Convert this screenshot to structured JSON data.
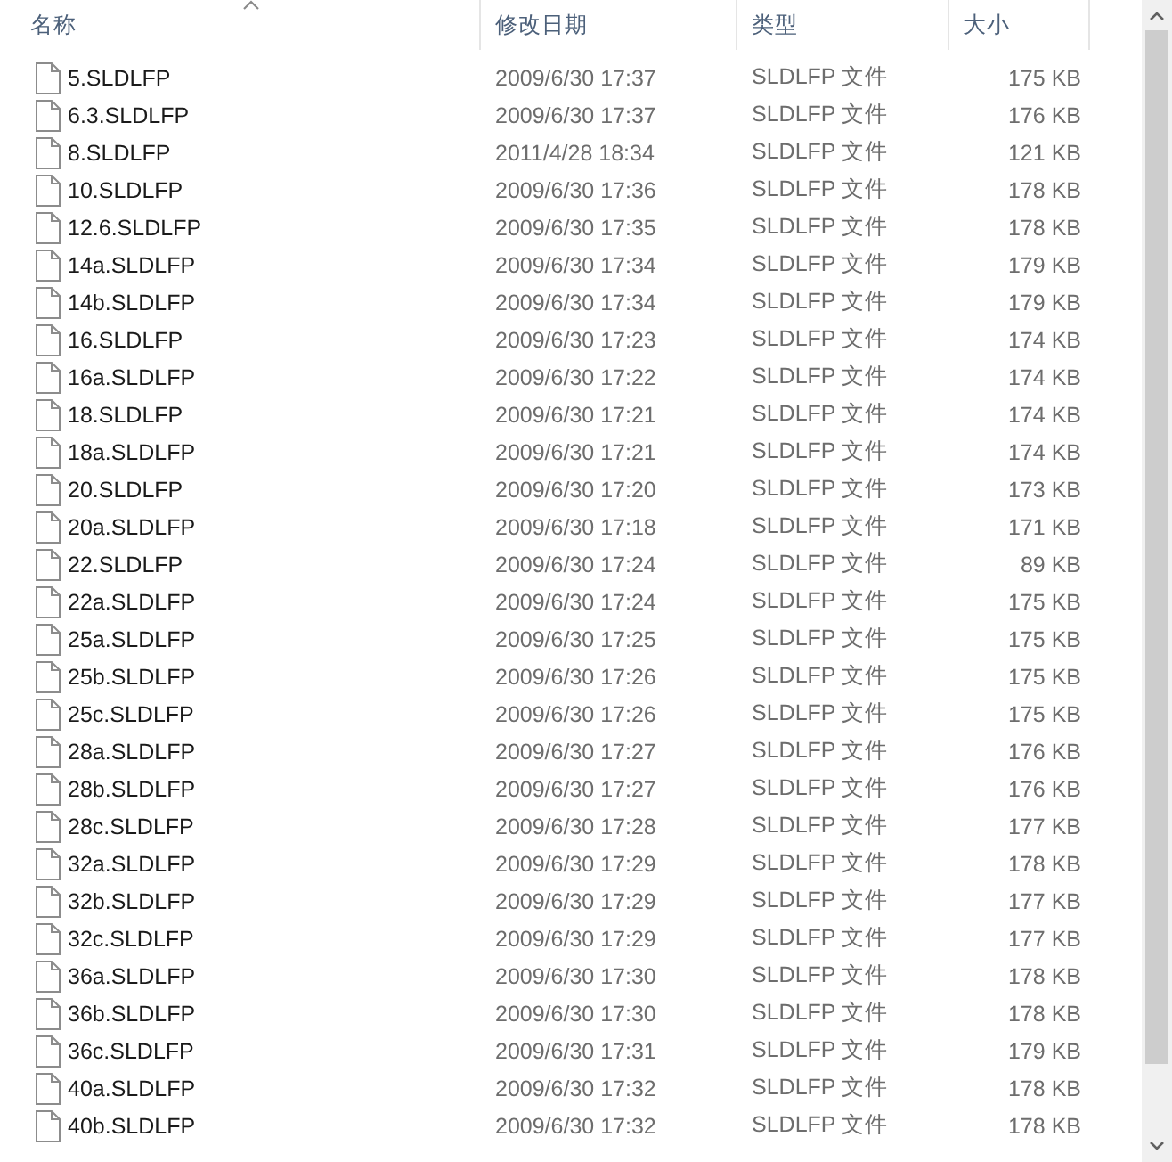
{
  "columns": [
    {
      "label": "名称",
      "sorted": true
    },
    {
      "label": "修改日期",
      "sorted": false
    },
    {
      "label": "类型",
      "sorted": false
    },
    {
      "label": "大小",
      "sorted": false
    }
  ],
  "rows": [
    {
      "name": "5.SLDLFP",
      "modified": "2009/6/30 17:37",
      "type": "SLDLFP 文件",
      "size": "175 KB"
    },
    {
      "name": "6.3.SLDLFP",
      "modified": "2009/6/30 17:37",
      "type": "SLDLFP 文件",
      "size": "176 KB"
    },
    {
      "name": "8.SLDLFP",
      "modified": "2011/4/28 18:34",
      "type": "SLDLFP 文件",
      "size": "121 KB"
    },
    {
      "name": "10.SLDLFP",
      "modified": "2009/6/30 17:36",
      "type": "SLDLFP 文件",
      "size": "178 KB"
    },
    {
      "name": "12.6.SLDLFP",
      "modified": "2009/6/30 17:35",
      "type": "SLDLFP 文件",
      "size": "178 KB"
    },
    {
      "name": "14a.SLDLFP",
      "modified": "2009/6/30 17:34",
      "type": "SLDLFP 文件",
      "size": "179 KB"
    },
    {
      "name": "14b.SLDLFP",
      "modified": "2009/6/30 17:34",
      "type": "SLDLFP 文件",
      "size": "179 KB"
    },
    {
      "name": "16.SLDLFP",
      "modified": "2009/6/30 17:23",
      "type": "SLDLFP 文件",
      "size": "174 KB"
    },
    {
      "name": "16a.SLDLFP",
      "modified": "2009/6/30 17:22",
      "type": "SLDLFP 文件",
      "size": "174 KB"
    },
    {
      "name": "18.SLDLFP",
      "modified": "2009/6/30 17:21",
      "type": "SLDLFP 文件",
      "size": "174 KB"
    },
    {
      "name": "18a.SLDLFP",
      "modified": "2009/6/30 17:21",
      "type": "SLDLFP 文件",
      "size": "174 KB"
    },
    {
      "name": "20.SLDLFP",
      "modified": "2009/6/30 17:20",
      "type": "SLDLFP 文件",
      "size": "173 KB"
    },
    {
      "name": "20a.SLDLFP",
      "modified": "2009/6/30 17:18",
      "type": "SLDLFP 文件",
      "size": "171 KB"
    },
    {
      "name": "22.SLDLFP",
      "modified": "2009/6/30 17:24",
      "type": "SLDLFP 文件",
      "size": "89 KB"
    },
    {
      "name": "22a.SLDLFP",
      "modified": "2009/6/30 17:24",
      "type": "SLDLFP 文件",
      "size": "175 KB"
    },
    {
      "name": "25a.SLDLFP",
      "modified": "2009/6/30 17:25",
      "type": "SLDLFP 文件",
      "size": "175 KB"
    },
    {
      "name": "25b.SLDLFP",
      "modified": "2009/6/30 17:26",
      "type": "SLDLFP 文件",
      "size": "175 KB"
    },
    {
      "name": "25c.SLDLFP",
      "modified": "2009/6/30 17:26",
      "type": "SLDLFP 文件",
      "size": "175 KB"
    },
    {
      "name": "28a.SLDLFP",
      "modified": "2009/6/30 17:27",
      "type": "SLDLFP 文件",
      "size": "176 KB"
    },
    {
      "name": "28b.SLDLFP",
      "modified": "2009/6/30 17:27",
      "type": "SLDLFP 文件",
      "size": "176 KB"
    },
    {
      "name": "28c.SLDLFP",
      "modified": "2009/6/30 17:28",
      "type": "SLDLFP 文件",
      "size": "177 KB"
    },
    {
      "name": "32a.SLDLFP",
      "modified": "2009/6/30 17:29",
      "type": "SLDLFP 文件",
      "size": "178 KB"
    },
    {
      "name": "32b.SLDLFP",
      "modified": "2009/6/30 17:29",
      "type": "SLDLFP 文件",
      "size": "177 KB"
    },
    {
      "name": "32c.SLDLFP",
      "modified": "2009/6/30 17:29",
      "type": "SLDLFP 文件",
      "size": "177 KB"
    },
    {
      "name": "36a.SLDLFP",
      "modified": "2009/6/30 17:30",
      "type": "SLDLFP 文件",
      "size": "178 KB"
    },
    {
      "name": "36b.SLDLFP",
      "modified": "2009/6/30 17:30",
      "type": "SLDLFP 文件",
      "size": "178 KB"
    },
    {
      "name": "36c.SLDLFP",
      "modified": "2009/6/30 17:31",
      "type": "SLDLFP 文件",
      "size": "179 KB"
    },
    {
      "name": "40a.SLDLFP",
      "modified": "2009/6/30 17:32",
      "type": "SLDLFP 文件",
      "size": "178 KB"
    },
    {
      "name": "40b.SLDLFP",
      "modified": "2009/6/30 17:32",
      "type": "SLDLFP 文件",
      "size": "178 KB"
    }
  ]
}
